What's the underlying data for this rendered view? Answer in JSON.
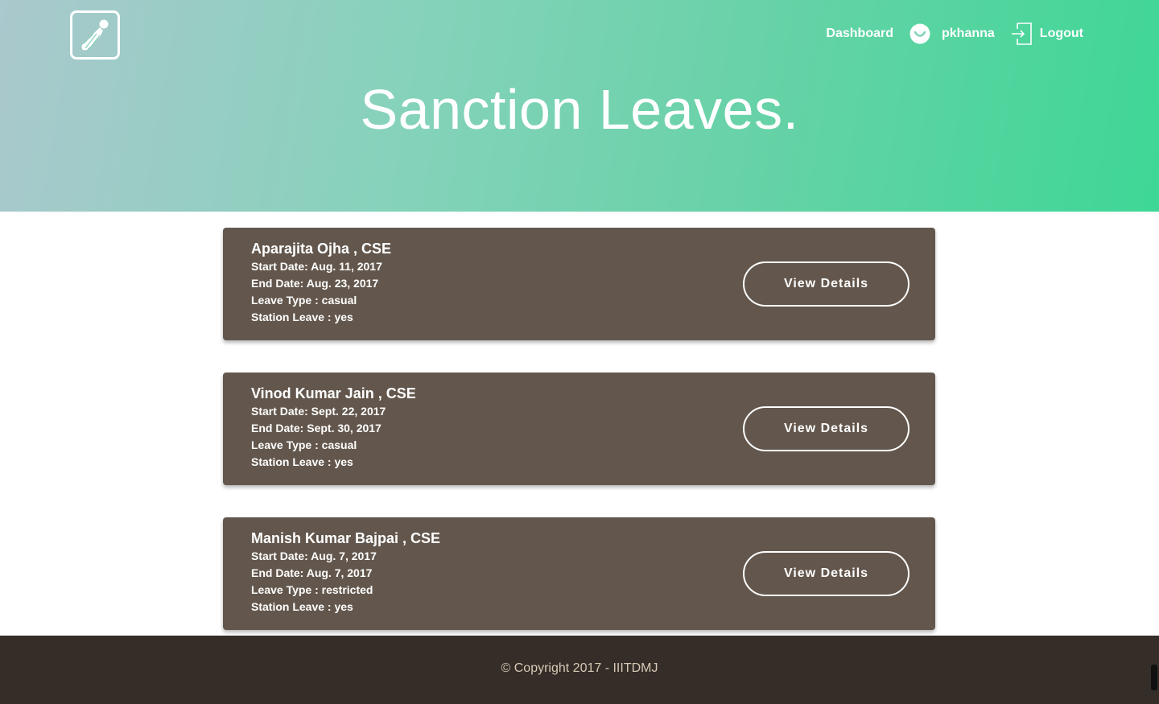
{
  "nav": {
    "dashboard": "Dashboard",
    "username": "pkhanna",
    "logout": "Logout",
    "user_icon": "user-avatar-icon",
    "logout_icon": "logout-icon"
  },
  "logo": {
    "icon": "shuttlecock-logo-icon"
  },
  "hero": {
    "title": "Sanction Leaves."
  },
  "leaves": [
    {
      "name": "Aparajita Ojha , CSE",
      "start": "Start Date: Aug. 11, 2017",
      "end": "End Date: Aug. 23, 2017",
      "type": "Leave Type : casual",
      "station": "Station Leave : yes",
      "button": "View Details"
    },
    {
      "name": "Vinod Kumar Jain , CSE",
      "start": "Start Date: Sept. 22, 2017",
      "end": "End Date: Sept. 30, 2017",
      "type": "Leave Type : casual",
      "station": "Station Leave : yes",
      "button": "View Details"
    },
    {
      "name": "Manish Kumar Bajpai , CSE",
      "start": "Start Date: Aug. 7, 2017",
      "end": "End Date: Aug. 7, 2017",
      "type": "Leave Type : restricted",
      "station": "Station Leave : yes",
      "button": "View Details"
    }
  ],
  "footer": {
    "copyright": "© Copyright 2017 - IIITDMJ"
  },
  "colors": {
    "hero_start": "#aac8cd",
    "hero_end": "#3ed796",
    "card_bg": "#63574d",
    "footer_bg": "#342d28",
    "footer_text": "#d8c9b4"
  }
}
